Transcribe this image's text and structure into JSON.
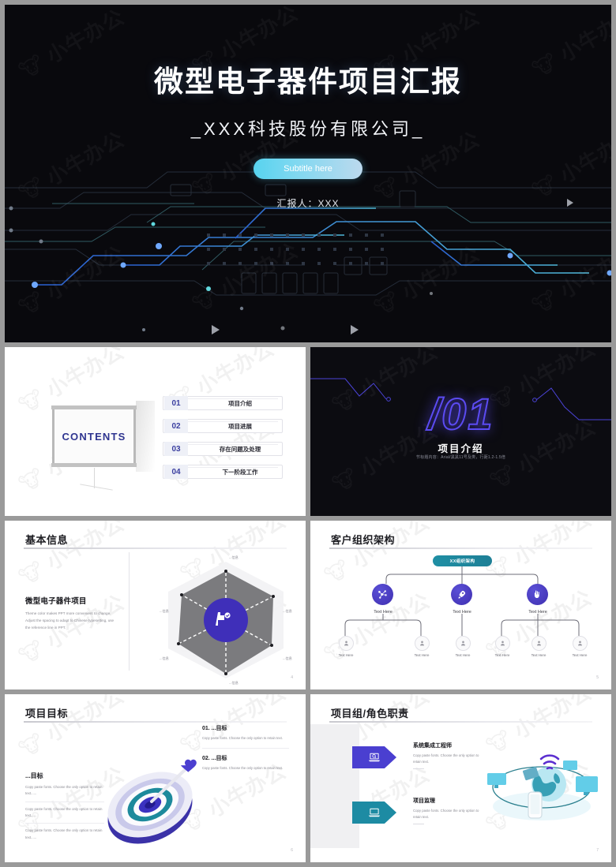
{
  "deck": {
    "watermark": "小牛办公",
    "accent_purple": "#4a3fd0",
    "accent_teal": "#1d8ba3",
    "accent_cyan": "#57d3ef"
  },
  "slide1": {
    "title": "微型电子器件项目汇报",
    "subtitle": "_XXX科技股份有限公司_",
    "pill_label": "Subtitle here",
    "reporter": "汇报人：XXX"
  },
  "slide2": {
    "heading": "CONTENTS",
    "items": [
      {
        "num": "01",
        "label": "项目介绍"
      },
      {
        "num": "02",
        "label": "项目进展"
      },
      {
        "num": "03",
        "label": "存在问题及处理"
      },
      {
        "num": "04",
        "label": "下一阶段工作"
      }
    ]
  },
  "slide3": {
    "big_number": "/01",
    "section_title": "项目介绍",
    "note": "节标题内容：Arial/黑黑11号及类，行距1.2-1.5倍"
  },
  "slide4": {
    "header": "基本信息",
    "project_name": "微型电子器件项目",
    "body": "Theme color makes PPT more convenient to change. Adjust the spacing to adapt to Chinese typesetting, use the reference line in PPT.",
    "page": "4",
    "radar_labels": [
      "...信息",
      "...信息",
      "...信息",
      "...信息",
      "...信息",
      "...信息"
    ]
  },
  "slide5": {
    "header": "客户组织架构",
    "root_label": "XX组织架构",
    "page": "5",
    "nodes": [
      {
        "label": "Text Here",
        "icon": "network-icon"
      },
      {
        "label": "Text Here",
        "icon": "rocket-icon"
      },
      {
        "label": "Text Here",
        "icon": "hand-icon"
      }
    ],
    "leaves": [
      {
        "label": "Text Here"
      },
      {
        "label": "Text Here"
      },
      {
        "label": "Text Here"
      },
      {
        "label": "Text Here"
      },
      {
        "label": "Text Here"
      },
      {
        "label": "Text Here"
      }
    ]
  },
  "slide6": {
    "header": "项目目标",
    "page": "6",
    "left_title": "...目标",
    "left_items": [
      "Copy paste fonts. Choose the only option to retain text......",
      "Copy paste fonts. Choose the only option to retain text......",
      "Copy paste fonts. Choose the only option to retain text......"
    ],
    "right_items": [
      {
        "title": "01. ...目标",
        "body": "Copy paste fonts. Choose the only option to retain text."
      },
      {
        "title": "02. ...目标",
        "body": "Copy paste fonts. Choose the only option to retain text."
      }
    ]
  },
  "slide7": {
    "header": "项目组/角色职责",
    "page": "7",
    "roles": [
      {
        "title": "系统集成工程师",
        "body": "Copy paste fonts. Choose the only option to retain text.",
        "icon": "laptop-search-icon"
      },
      {
        "title": "项目监理",
        "body": "Copy paste fonts. Choose the only option to retain text.",
        "icon": "monitor-icon"
      }
    ]
  }
}
